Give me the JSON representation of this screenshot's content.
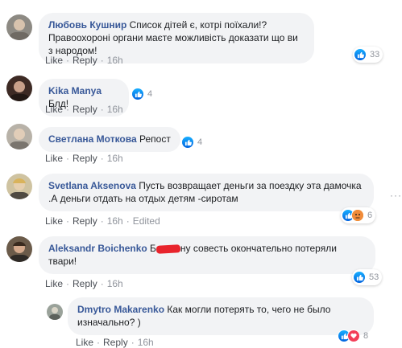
{
  "actions": {
    "like": "Like",
    "reply": "Reply",
    "edited": "Edited"
  },
  "comments": [
    {
      "author": "Любовь Кушнир",
      "text": "Список дітей є, котрі поїхали!? Правоохороні органи маєте можливість доказати що ви з народом!",
      "time": "16h",
      "reactions": "33"
    },
    {
      "author": "Kika Manya",
      "text": "Блд!",
      "time": "16h",
      "reactions": "4"
    },
    {
      "author": "Светлана Моткова",
      "text": "Репост",
      "time": "16h",
      "reactions": "4"
    },
    {
      "author": "Svetlana Aksenova",
      "text": "Пусть возвращает деньги за поездку эта дамочка .А деньги отдать на отдых детям -сиротам",
      "time": "16h",
      "reactions": "6"
    },
    {
      "author": "Aleksandr Boichenko",
      "text_start": "Б",
      "text_rest": "ну совесть окончательно потеряли твари!",
      "time": "16h",
      "reactions": "53"
    },
    {
      "author": "Dmytro Makarenko",
      "text": "Как могли потерять то, чего не было изначально? )",
      "time": "16h",
      "reactions": "8"
    }
  ],
  "more_menu_glyph": "···",
  "colors": {
    "author": "#385898",
    "bubble": "#f2f3f5",
    "like_blue": "#1877f2",
    "love_red": "#f33e58",
    "haha_yellow": "#f7b125",
    "redaction": "#e8242c"
  }
}
